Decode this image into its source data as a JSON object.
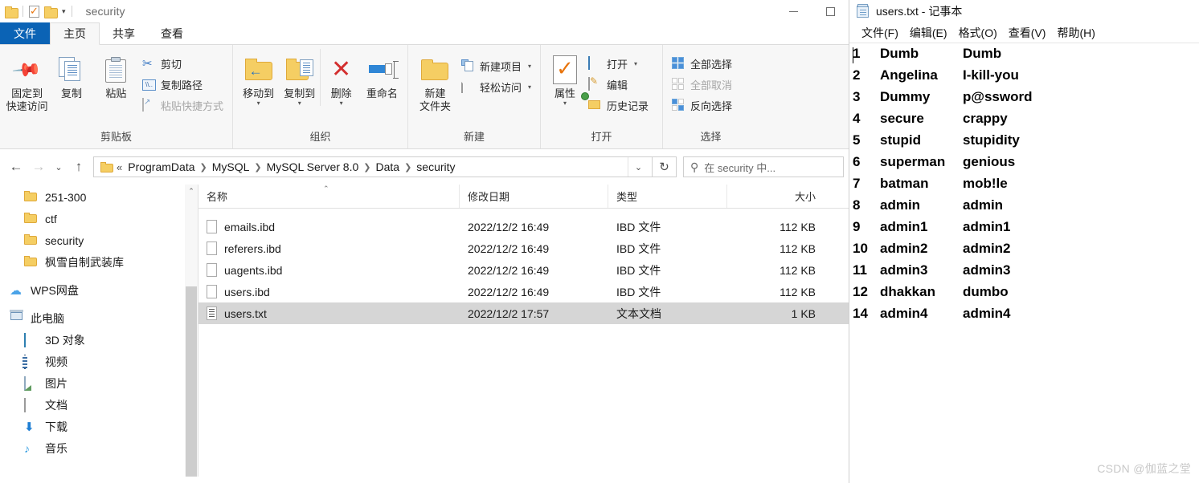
{
  "explorer": {
    "titlebar": {
      "title": "security",
      "quick_access": [
        "folder-icon",
        "properties-icon",
        "folder-icon"
      ],
      "dropdown": "▾"
    },
    "window_controls": {
      "minimize": "—",
      "maximize": "▢"
    },
    "tabs": [
      {
        "label": "文件",
        "state": "file"
      },
      {
        "label": "主页",
        "state": "active"
      },
      {
        "label": "共享",
        "state": "normal"
      },
      {
        "label": "查看",
        "state": "normal"
      }
    ],
    "ribbon": {
      "groups": [
        {
          "title": "剪贴板",
          "big_buttons": [
            {
              "label1": "固定到",
              "label2": "快速访问",
              "icon": "pin-icon"
            },
            {
              "label1": "复制",
              "label2": "",
              "icon": "copy-icon"
            },
            {
              "label1": "粘贴",
              "label2": "",
              "icon": "paste-icon"
            }
          ],
          "small_buttons": [
            {
              "label": "剪切",
              "icon": "scissors-icon",
              "dim": false
            },
            {
              "label": "复制路径",
              "icon": "copy-path-icon",
              "dim": false
            },
            {
              "label": "粘贴快捷方式",
              "icon": "paste-shortcut-icon",
              "dim": true
            }
          ]
        },
        {
          "title": "组织",
          "big_buttons": [
            {
              "label1": "移动到",
              "label2": "",
              "arrow": "▾",
              "icon": "move-to-icon"
            },
            {
              "label1": "复制到",
              "label2": "",
              "arrow": "▾",
              "icon": "copy-to-icon"
            },
            {
              "label1": "删除",
              "label2": "",
              "arrow": "▾",
              "icon": "delete-icon"
            },
            {
              "label1": "重命名",
              "label2": "",
              "icon": "rename-icon"
            }
          ],
          "small_buttons": []
        },
        {
          "title": "新建",
          "big_buttons": [
            {
              "label1": "新建",
              "label2": "文件夹",
              "icon": "new-folder-icon"
            }
          ],
          "small_buttons": [
            {
              "label": "新建项目",
              "icon": "new-item-icon",
              "dropdown": "▾",
              "dim": false
            },
            {
              "label": "轻松访问",
              "icon": "easy-access-icon",
              "dropdown": "▾",
              "dim": false
            }
          ]
        },
        {
          "title": "打开",
          "big_buttons": [
            {
              "label1": "属性",
              "label2": "",
              "arrow": "▾",
              "icon": "properties-icon"
            }
          ],
          "small_buttons": [
            {
              "label": "打开",
              "icon": "open-icon",
              "dropdown": "▾",
              "dim": false
            },
            {
              "label": "编辑",
              "icon": "edit-icon",
              "dim": false
            },
            {
              "label": "历史记录",
              "icon": "history-icon",
              "dim": false
            }
          ]
        },
        {
          "title": "选择",
          "big_buttons": [],
          "small_buttons": [
            {
              "label": "全部选择",
              "icon": "select-all-icon",
              "dim": false
            },
            {
              "label": "全部取消",
              "icon": "select-none-icon",
              "dim": true
            },
            {
              "label": "反向选择",
              "icon": "invert-selection-icon",
              "dim": false
            }
          ]
        }
      ]
    },
    "addressbar": {
      "back": "←",
      "forward": "→",
      "recent": "⌄",
      "up": "↑",
      "root_chevron": "«",
      "crumbs": [
        "ProgramData",
        "MySQL",
        "MySQL Server 8.0",
        "Data",
        "security"
      ],
      "dropdown": "⌄",
      "refresh": "↻",
      "search_placeholder": "在 security 中..."
    },
    "sidebar": {
      "items": [
        {
          "label": "251-300",
          "icon": "folder-icon",
          "level": 1
        },
        {
          "label": "ctf",
          "icon": "folder-icon",
          "level": 1
        },
        {
          "label": "security",
          "icon": "folder-icon",
          "level": 1
        },
        {
          "label": "枫雪自制武装库",
          "icon": "folder-icon",
          "level": 1
        },
        {
          "label": "WPS网盘",
          "icon": "cloud-icon",
          "level": 0
        },
        {
          "label": "此电脑",
          "icon": "this-pc-icon",
          "level": 0
        },
        {
          "label": "3D 对象",
          "icon": "3d-objects-icon",
          "level": 1
        },
        {
          "label": "视频",
          "icon": "videos-icon",
          "level": 1
        },
        {
          "label": "图片",
          "icon": "pictures-icon",
          "level": 1
        },
        {
          "label": "文档",
          "icon": "documents-icon",
          "level": 1
        },
        {
          "label": "下载",
          "icon": "downloads-icon",
          "level": 1
        },
        {
          "label": "音乐",
          "icon": "music-icon",
          "level": 1
        }
      ],
      "scroll_up": "⌃"
    },
    "filelist": {
      "sort_indicator": "⌃",
      "columns": [
        "名称",
        "修改日期",
        "类型",
        "大小"
      ],
      "rows": [
        {
          "name": "emails.ibd",
          "date": "2022/12/2 16:49",
          "type": "IBD 文件",
          "size": "112 KB",
          "icon": "file-icon",
          "selected": false
        },
        {
          "name": "referers.ibd",
          "date": "2022/12/2 16:49",
          "type": "IBD 文件",
          "size": "112 KB",
          "icon": "file-icon",
          "selected": false
        },
        {
          "name": "uagents.ibd",
          "date": "2022/12/2 16:49",
          "type": "IBD 文件",
          "size": "112 KB",
          "icon": "file-icon",
          "selected": false
        },
        {
          "name": "users.ibd",
          "date": "2022/12/2 16:49",
          "type": "IBD 文件",
          "size": "112 KB",
          "icon": "file-icon",
          "selected": false
        },
        {
          "name": "users.txt",
          "date": "2022/12/2 17:57",
          "type": "文本文档",
          "size": "1 KB",
          "icon": "text-file-icon",
          "selected": true
        }
      ]
    }
  },
  "notepad": {
    "title": "users.txt - 记事本",
    "icon": "notepad-icon",
    "menus": [
      "文件(F)",
      "编辑(E)",
      "格式(O)",
      "查看(V)",
      "帮助(H)"
    ],
    "lines": [
      {
        "num": "1",
        "user": "Dumb",
        "pass": "Dumb"
      },
      {
        "num": "2",
        "user": "Angelina",
        "pass": "I-kill-you"
      },
      {
        "num": "3",
        "user": "Dummy",
        "pass": "p@ssword"
      },
      {
        "num": "4",
        "user": "secure",
        "pass": "crappy"
      },
      {
        "num": "5",
        "user": "stupid",
        "pass": "stupidity"
      },
      {
        "num": "6",
        "user": "superman",
        "pass": "genious"
      },
      {
        "num": "7",
        "user": "batman",
        "pass": "mob!le"
      },
      {
        "num": "8",
        "user": "admin",
        "pass": "admin"
      },
      {
        "num": "9",
        "user": "admin1",
        "pass": "admin1"
      },
      {
        "num": "10",
        "user": "admin2",
        "pass": "admin2"
      },
      {
        "num": "11",
        "user": "admin3",
        "pass": "admin3"
      },
      {
        "num": "12",
        "user": "dhakkan",
        "pass": "dumbo"
      },
      {
        "num": "14",
        "user": "admin4",
        "pass": "admin4"
      }
    ]
  },
  "watermark": "CSDN @伽蓝之堂"
}
